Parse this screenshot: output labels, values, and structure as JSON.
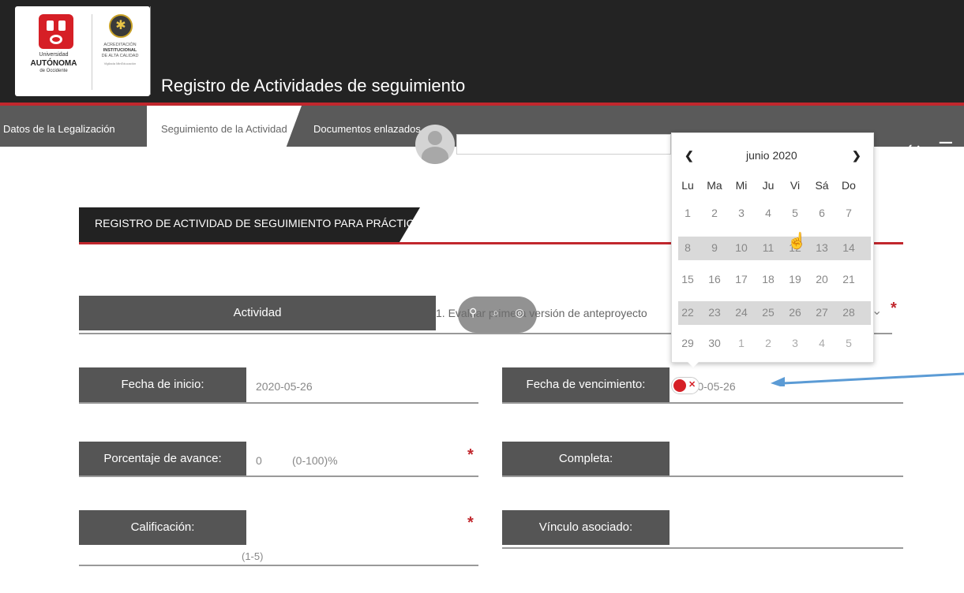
{
  "header": {
    "title": "Registro de Actividades de seguimiento",
    "logo": {
      "line1": "Universidad",
      "line2": "AUTÓNOMA",
      "line3": "de Occidente",
      "acred1": "ACREDITACIÓN",
      "acred2": "INSTITUCIONAL",
      "acred3": "DE ALTA CALIDAD",
      "acred4": "Vigilada MinEducación"
    }
  },
  "tabs": [
    {
      "label": "Datos de la Legalización"
    },
    {
      "label": "Seguimiento de la Actividad",
      "active": true
    },
    {
      "label": "Documentos enlazados"
    }
  ],
  "section": {
    "title": "REGISTRO DE ACTIVIDAD DE SEGUIMIENTO PARA PRÁCTICAS"
  },
  "form": {
    "actividad": {
      "label": "Actividad",
      "value": "1. Evaluar primera versión de anteproyecto"
    },
    "fecha_inicio": {
      "label": "Fecha de inicio:",
      "value": "2020-05-26"
    },
    "fecha_vencimiento": {
      "label": "Fecha de vencimiento:",
      "value": "2020-05-26"
    },
    "porcentaje": {
      "label": "Porcentaje de avance:",
      "value": "0",
      "hint": "(0-100)%"
    },
    "completa": {
      "label": "Completa:",
      "checked": false
    },
    "calificacion": {
      "label": "Calificación:",
      "value": "",
      "hint": "(1-5)"
    },
    "vinculo": {
      "label": "Vínculo asociado:",
      "value": ""
    },
    "required_mark": "*"
  },
  "datepicker": {
    "month_label": "junio 2020",
    "prev_icon": "chevron-left-icon",
    "next_icon": "chevron-right-icon",
    "weekdays": [
      "Lu",
      "Ma",
      "Mi",
      "Ju",
      "Vi",
      "Sá",
      "Do"
    ],
    "weeks": [
      [
        "1",
        "2",
        "3",
        "4",
        "5",
        "6",
        "7"
      ],
      [
        "8",
        "9",
        "10",
        "11",
        "12",
        "13",
        "14"
      ],
      [
        "15",
        "16",
        "17",
        "18",
        "19",
        "20",
        "21"
      ],
      [
        "22",
        "23",
        "24",
        "25",
        "26",
        "27",
        "28"
      ],
      [
        "29",
        "30",
        "1",
        "2",
        "3",
        "4",
        "5"
      ]
    ]
  },
  "colors": {
    "header_bg": "#232323",
    "tabbar_bg": "#5a5a5a",
    "accent_red": "#c1272d",
    "label_bg": "#555555",
    "arrow": "#5b9bd5"
  }
}
